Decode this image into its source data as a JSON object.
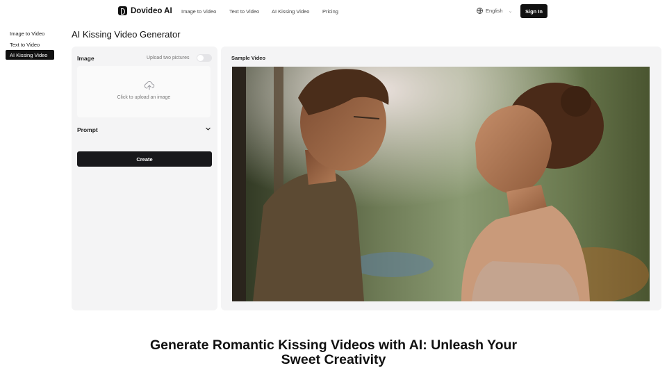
{
  "brand": {
    "name": "Dovideo AI"
  },
  "nav": {
    "links": [
      "Image to Video",
      "Text to Video",
      "AI Kissing Video",
      "Pricing"
    ],
    "language": "English",
    "sign_in": "Sign In"
  },
  "sidebar": {
    "items": [
      {
        "label": "Image to Video",
        "active": false
      },
      {
        "label": "Text to Video",
        "active": false
      },
      {
        "label": "AI Kissing Video",
        "active": true
      }
    ]
  },
  "page": {
    "title": "AI Kissing Video Generator"
  },
  "form": {
    "image_label": "Image",
    "upload_two_label": "Upload two pictures",
    "upload_two_enabled": false,
    "upload_prompt": "Click to upload an image",
    "prompt_label": "Prompt",
    "create_label": "Create"
  },
  "sample": {
    "label": "Sample Video"
  },
  "headline": {
    "line1": "Generate Romantic Kissing Videos with AI: Unleash Your",
    "line2": "Sweet Creativity"
  },
  "colors": {
    "accent": "#111111",
    "panel_bg": "#f4f4f5"
  }
}
